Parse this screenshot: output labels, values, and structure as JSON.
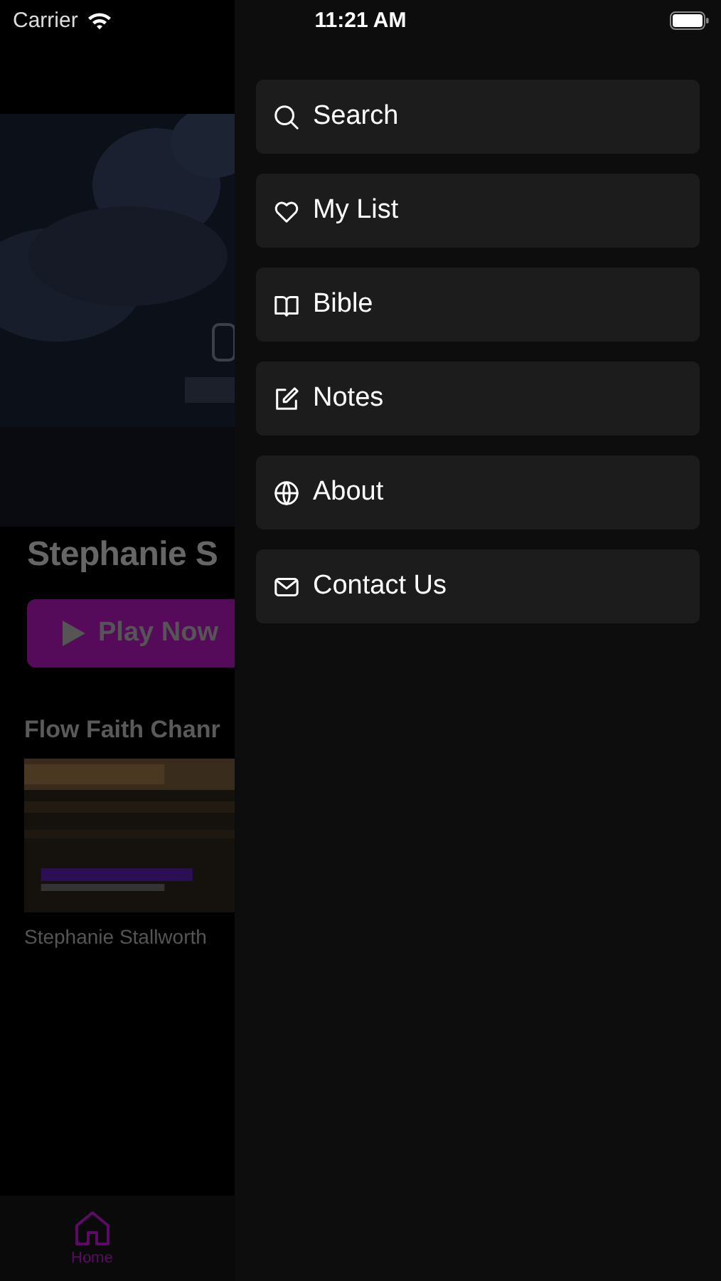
{
  "status_bar": {
    "carrier": "Carrier",
    "time": "11:21 AM"
  },
  "background": {
    "title": "Stephanie S",
    "play_button": "Play Now",
    "section_title": "Flow Faith Chanr",
    "video": {
      "kind": "picture",
      "caption": "Stephanie Stallworth"
    }
  },
  "tab_bar": [
    {
      "label": "Home",
      "selected": true
    }
  ],
  "menu": [
    {
      "label": "Search"
    },
    {
      "label": "My List"
    },
    {
      "label": "Bible"
    },
    {
      "label": "Notes"
    },
    {
      "label": "About"
    },
    {
      "label": "Contact Us"
    }
  ]
}
